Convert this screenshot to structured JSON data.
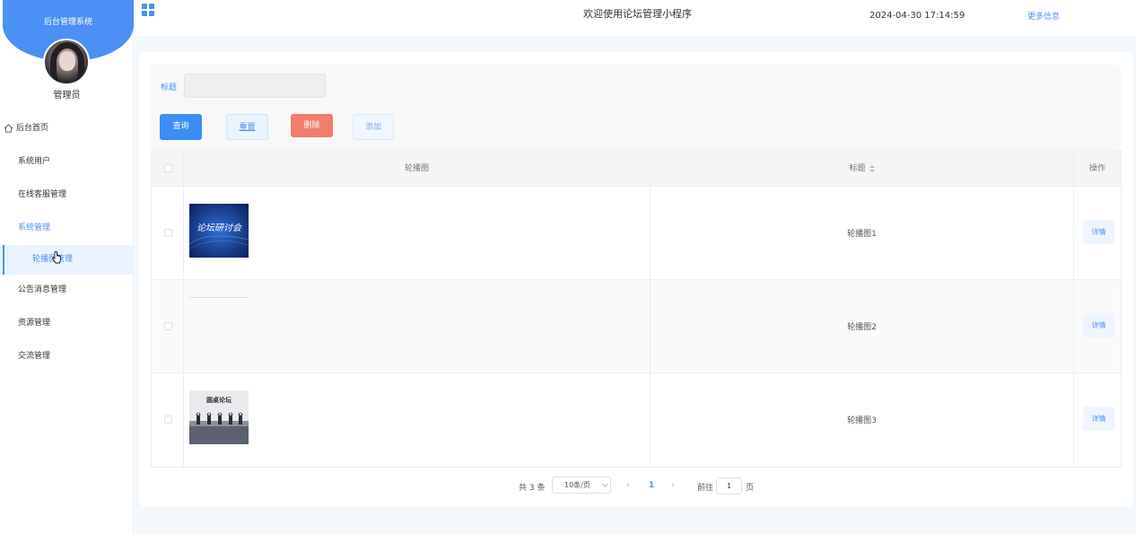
{
  "sidebar": {
    "system_title": "后台管理系统",
    "role": "管理员",
    "menu": [
      {
        "label": "后台首页",
        "icon": "home-icon"
      },
      {
        "label": "系统用户"
      },
      {
        "label": "在线客服管理"
      },
      {
        "label": "系统管理",
        "active": true
      },
      {
        "label": "公告消息管理"
      },
      {
        "label": "资源管理"
      },
      {
        "label": "交流管理"
      }
    ],
    "submenu_active": "轮播图管理"
  },
  "topbar": {
    "welcome": "欢迎使用论坛管理小程序",
    "datetime": "2024-04-30 17:14:59",
    "more_info": "更多信息"
  },
  "filter": {
    "title_label": "标题",
    "title_value": "",
    "buttons": {
      "search": "查询",
      "reset": "重置",
      "delete": "删除",
      "add": "添加"
    }
  },
  "table": {
    "columns": [
      "轮播图",
      "标题",
      "操作"
    ],
    "rows": [
      {
        "title": "轮播图1",
        "image": "banner-forum-seminar",
        "action": "详情"
      },
      {
        "title": "轮播图2",
        "image": "",
        "action": "详情"
      },
      {
        "title": "轮播图3",
        "image": "banner-roundtable-forum",
        "action": "详情"
      }
    ]
  },
  "thumb_text": {
    "row1": "论坛研讨会",
    "row3": "圆桌论坛"
  },
  "pagination": {
    "total": "共 3 条",
    "page_size": "10条/页",
    "current_page": "1",
    "goto_label": "前往",
    "goto_value": "1",
    "page_suffix": "页"
  },
  "colors": {
    "primary": "#4a90f5",
    "danger": "#f47c6b",
    "background": "#f3f8fd"
  }
}
